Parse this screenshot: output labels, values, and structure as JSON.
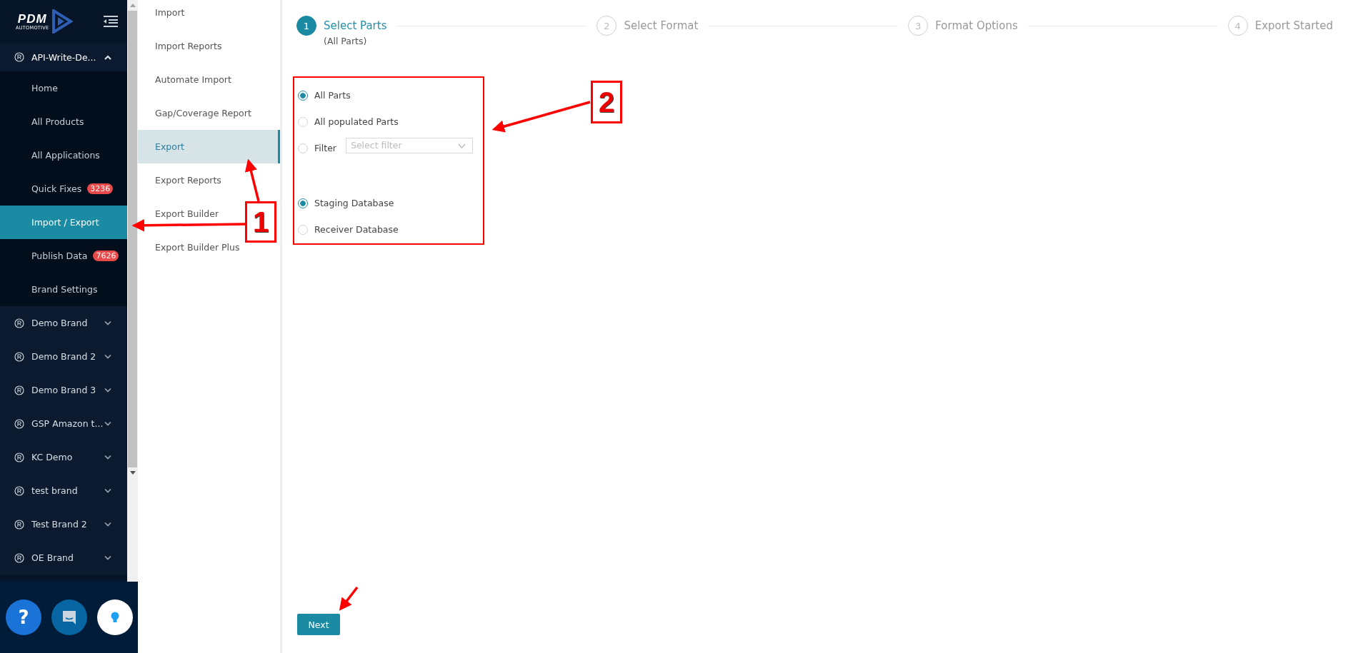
{
  "sidebar": {
    "logo": {
      "name": "PDM",
      "tagline": "AUTOMOTIVE"
    },
    "brands": [
      {
        "label": "API-Write-De...",
        "expanded": true,
        "children": [
          {
            "label": "Home",
            "selected": false
          },
          {
            "label": "All Products",
            "selected": false
          },
          {
            "label": "All Applications",
            "selected": false
          },
          {
            "label": "Quick Fixes",
            "badge": "3236",
            "selected": false
          },
          {
            "label": "Import / Export",
            "selected": true
          },
          {
            "label": "Publish Data",
            "badge": "7626",
            "selected": false
          },
          {
            "label": "Brand Settings",
            "selected": false
          }
        ]
      },
      {
        "label": "Demo Brand",
        "expanded": false
      },
      {
        "label": "Demo Brand 2",
        "expanded": false
      },
      {
        "label": "Demo Brand 3",
        "expanded": false
      },
      {
        "label": "GSP Amazon t...",
        "expanded": false
      },
      {
        "label": "KC Demo",
        "expanded": false
      },
      {
        "label": "test brand",
        "expanded": false
      },
      {
        "label": "Test Brand 2",
        "expanded": false
      },
      {
        "label": "OE Brand",
        "expanded": false
      }
    ],
    "help_button": {
      "label": "?"
    }
  },
  "submenu": {
    "items": [
      {
        "label": "Import",
        "selected": false
      },
      {
        "label": "Import Reports",
        "selected": false
      },
      {
        "label": "Automate Import",
        "selected": false
      },
      {
        "label": "Gap/Coverage Report",
        "selected": false
      },
      {
        "label": "Export",
        "selected": true
      },
      {
        "label": "Export Reports",
        "selected": false
      },
      {
        "label": "Export Builder",
        "selected": false
      },
      {
        "label": "Export Builder Plus",
        "selected": false
      }
    ]
  },
  "stepper": {
    "steps": [
      {
        "number": "1",
        "label": "Select Parts",
        "sublabel": "(All Parts)",
        "active": true
      },
      {
        "number": "2",
        "label": "Select Format",
        "active": false
      },
      {
        "number": "3",
        "label": "Format Options",
        "active": false
      },
      {
        "number": "4",
        "label": "Export Started",
        "active": false
      }
    ]
  },
  "form": {
    "scope_options": [
      {
        "label": "All Parts",
        "selected": true
      },
      {
        "label": "All populated Parts",
        "selected": false
      },
      {
        "label": "Filter",
        "selected": false,
        "kind": "filter",
        "placeholder": "Select filter"
      }
    ],
    "database_options": [
      {
        "label": "Staging Database",
        "selected": true
      },
      {
        "label": "Receiver Database",
        "selected": false
      }
    ],
    "next_button": {
      "label": "Next"
    }
  },
  "annotations": [
    {
      "label": "1"
    },
    {
      "label": "2"
    }
  ]
}
